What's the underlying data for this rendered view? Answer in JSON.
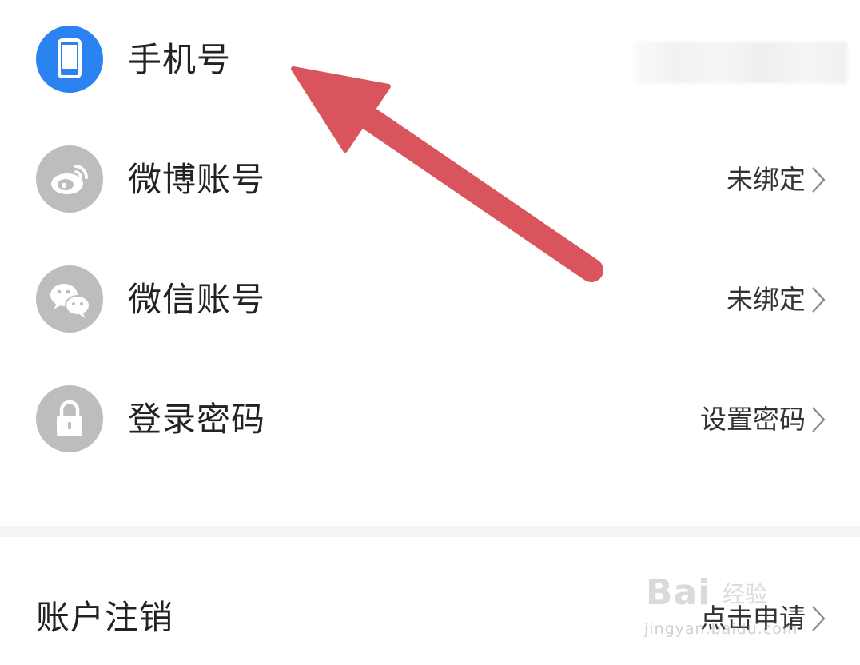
{
  "rows": [
    {
      "label": "手机号",
      "value": "",
      "icon": "phone-icon",
      "color": "#2a83f0"
    },
    {
      "label": "微博账号",
      "value": "未绑定",
      "icon": "weibo-icon",
      "color": "#bdbdbd"
    },
    {
      "label": "微信账号",
      "value": "未绑定",
      "icon": "wechat-icon",
      "color": "#bdbdbd"
    },
    {
      "label": "登录密码",
      "value": "设置密码",
      "icon": "lock-icon",
      "color": "#bdbdbd"
    }
  ],
  "cancel": {
    "label": "账户注销",
    "value": "点击申请"
  },
  "annotation": {
    "arrow_color": "#d9545c"
  },
  "watermark": {
    "brand": "Bai",
    "sub": "经验",
    "url": "jingyan.baidu.com"
  }
}
